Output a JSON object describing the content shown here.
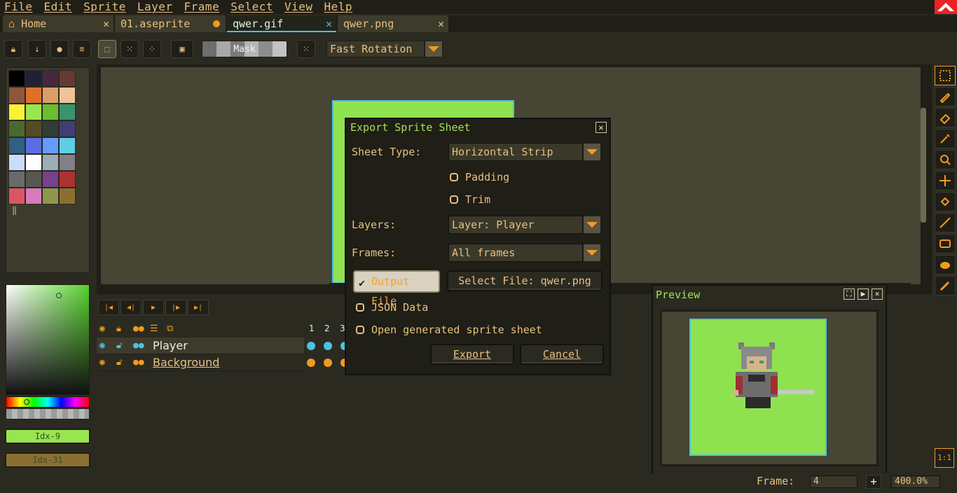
{
  "menu": [
    "File",
    "Edit",
    "Sprite",
    "Layer",
    "Frame",
    "Select",
    "View",
    "Help"
  ],
  "tabs": [
    {
      "label": "Home",
      "icon": "home-icon"
    },
    {
      "label": "01.aseprite",
      "modified": true
    },
    {
      "label": "qwer.gif",
      "active": true
    },
    {
      "label": "qwer.png"
    }
  ],
  "toolbar": {
    "mask_label": "Mask",
    "rotation_value": "Fast Rotation"
  },
  "palette": {
    "colors": [
      "#000000",
      "#222034",
      "#45283c",
      "#663931",
      "#8f563b",
      "#df7126",
      "#d9a066",
      "#eec39a",
      "#fbf236",
      "#99e550",
      "#6abe30",
      "#37946e",
      "#4b692f",
      "#524b24",
      "#323c39",
      "#3f3f74",
      "#306082",
      "#5b6ee1",
      "#639bff",
      "#5fcde4",
      "#cbdbfc",
      "#ffffff",
      "#9badb7",
      "#847e87",
      "#696a6a",
      "#595652",
      "#76428a",
      "#ac3232",
      "#d95763",
      "#d77bba",
      "#8f974a",
      "#8a6f30"
    ]
  },
  "colors": {
    "fg_label": "Idx-9",
    "fg_color": "#99e550",
    "bg_label": "Idx-31",
    "bg_color": "#8a6f30",
    "accent": "#f39a1e",
    "sprite_bg": "#8fe24f",
    "selection": "#4ac2e0"
  },
  "timeline": {
    "frame_numbers": [
      "1",
      "2",
      "3"
    ],
    "layers": [
      {
        "name": "Player",
        "selected": true,
        "cel_color": "#4ac2e0"
      },
      {
        "name": "Background",
        "selected": false,
        "cel_color": "#f39a1e"
      }
    ]
  },
  "dialog": {
    "title": "Export Sprite Sheet",
    "sheet_type_label": "Sheet Type:",
    "sheet_type_value": "Horizontal Strip",
    "padding_label": "Padding",
    "trim_label": "Trim",
    "layers_label": "Layers:",
    "layers_value": "Layer: Player",
    "frames_label": "Frames:",
    "frames_value": "All frames",
    "output_file_label": "Output File",
    "select_file_label": "Select File: qwer.png",
    "json_data_label": "JSON Data",
    "open_generated_label": "Open generated sprite sheet",
    "export_label": "Export",
    "cancel_label": "Cancel"
  },
  "preview": {
    "title": "Preview"
  },
  "status": {
    "frame_label": "Frame:",
    "frame_value": "4",
    "zoom_value": "400.0%",
    "one_to_one_label": "1:1"
  }
}
